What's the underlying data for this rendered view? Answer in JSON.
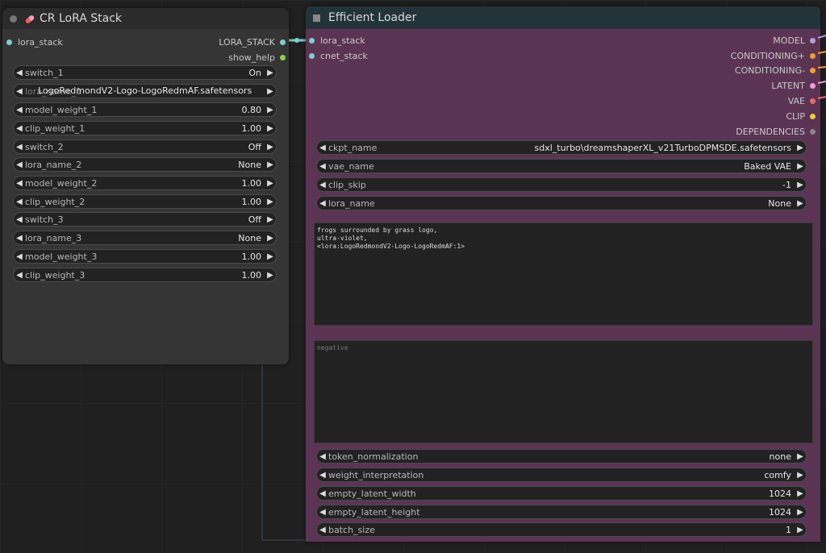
{
  "left_node": {
    "title": "CR LoRA Stack",
    "inputs": [
      {
        "label": "lora_stack",
        "color": "#7ecfcf"
      }
    ],
    "outputs": [
      {
        "label": "LORA_STACK",
        "color": "#7ecfcf"
      },
      {
        "label": "show_help",
        "color": "#8fcf45"
      }
    ],
    "widgets": [
      {
        "label": "switch_1",
        "value": "On"
      },
      {
        "label": "lora_name_1",
        "value": "LogoRedmondV2-Logo-LogoRedmAF.safetensors"
      },
      {
        "label": "model_weight_1",
        "value": "0.80"
      },
      {
        "label": "clip_weight_1",
        "value": "1.00"
      },
      {
        "label": "switch_2",
        "value": "Off"
      },
      {
        "label": "lora_name_2",
        "value": "None"
      },
      {
        "label": "model_weight_2",
        "value": "1.00"
      },
      {
        "label": "clip_weight_2",
        "value": "1.00"
      },
      {
        "label": "switch_3",
        "value": "Off"
      },
      {
        "label": "lora_name_3",
        "value": "None"
      },
      {
        "label": "model_weight_3",
        "value": "1.00"
      },
      {
        "label": "clip_weight_3",
        "value": "1.00"
      }
    ]
  },
  "right_node": {
    "title": "Efficient Loader",
    "inputs": [
      {
        "label": "lora_stack",
        "color": "#7ecfcf"
      },
      {
        "label": "cnet_stack",
        "color": "#7ecfcf"
      }
    ],
    "outputs": [
      {
        "label": "MODEL",
        "color": "#b39ddb"
      },
      {
        "label": "CONDITIONING+",
        "color": "#f0a030"
      },
      {
        "label": "CONDITIONING-",
        "color": "#f0a030"
      },
      {
        "label": "LATENT",
        "color": "#f59ad6"
      },
      {
        "label": "VAE",
        "color": "#f06a6a"
      },
      {
        "label": "CLIP",
        "color": "#f0d030"
      },
      {
        "label": "DEPENDENCIES",
        "color": "#888888"
      }
    ],
    "widgets_top": [
      {
        "label": "ckpt_name",
        "value": "sdxl_turbo\\dreamshaperXL_v21TurboDPMSDE.safetensors"
      },
      {
        "label": "vae_name",
        "value": "Baked VAE"
      },
      {
        "label": "clip_skip",
        "value": "-1"
      },
      {
        "label": "lora_name",
        "value": "None"
      }
    ],
    "positive_prompt": "frogs surrounded by grass logo,\nultra-violet,\n<lora:LogoRedmondV2-Logo-LogoRedmAF:1>",
    "negative_placeholder": "negative",
    "widgets_bottom": [
      {
        "label": "token_normalization",
        "value": "none"
      },
      {
        "label": "weight_interpretation",
        "value": "comfy"
      },
      {
        "label": "empty_latent_width",
        "value": "1024"
      },
      {
        "label": "empty_latent_height",
        "value": "1024"
      },
      {
        "label": "batch_size",
        "value": "1"
      }
    ]
  },
  "colors": {
    "left_node_bg": "#353535",
    "right_node_bg": "#5b3454",
    "link": "#7ecfcf"
  }
}
